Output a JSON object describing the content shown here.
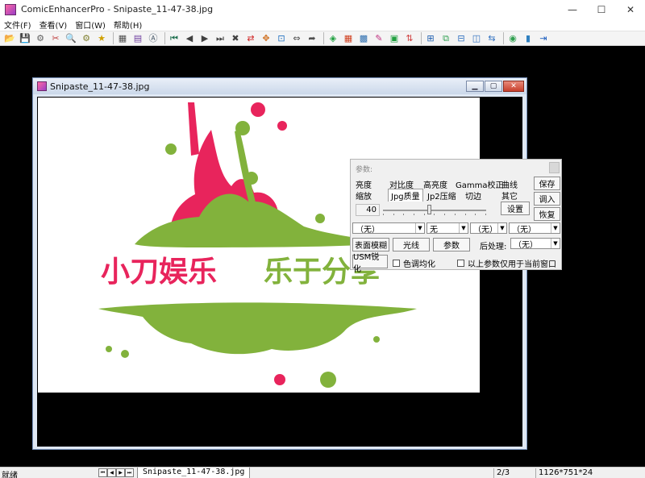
{
  "window": {
    "title": "ComicEnhancerPro - Snipaste_11-47-38.jpg",
    "minimize": "—",
    "maximize": "☐",
    "close": "✕"
  },
  "menu": [
    "文件(F)",
    "查看(V)",
    "窗口(W)",
    "帮助(H)"
  ],
  "toolbar": [
    {
      "icon": "open-folder-icon",
      "glyph": "📂"
    },
    {
      "icon": "save-icon",
      "glyph": "💾"
    },
    {
      "icon": "batch-icon",
      "glyph": "⚙"
    },
    {
      "icon": "tools-icon",
      "glyph": "✂"
    },
    {
      "icon": "zoom-icon",
      "glyph": "🔍"
    },
    {
      "icon": "settings-icon",
      "glyph": "⚙"
    },
    {
      "icon": "star-icon",
      "glyph": "★"
    },
    {
      "sep": true
    },
    {
      "icon": "palette-icon",
      "glyph": "▦"
    },
    {
      "icon": "pages-icon",
      "glyph": "▤"
    },
    {
      "icon": "text-icon",
      "glyph": "Ⓐ"
    },
    {
      "sep": true
    },
    {
      "icon": "first-icon",
      "glyph": "⏮"
    },
    {
      "icon": "prev-icon",
      "glyph": "◀"
    },
    {
      "icon": "next-icon",
      "glyph": "▶"
    },
    {
      "icon": "last-icon",
      "glyph": "⏭"
    },
    {
      "icon": "delete-icon",
      "glyph": "✖"
    },
    {
      "icon": "swap-icon",
      "glyph": "⇄"
    },
    {
      "icon": "move-icon",
      "glyph": "✥"
    },
    {
      "icon": "fit-icon",
      "glyph": "⊡"
    },
    {
      "icon": "fit-width-icon",
      "glyph": "⇔"
    },
    {
      "icon": "export-icon",
      "glyph": "➦"
    },
    {
      "sep": true
    },
    {
      "icon": "color-icon",
      "glyph": "◈"
    },
    {
      "icon": "grid-icon",
      "glyph": "▦"
    },
    {
      "icon": "mosaic-icon",
      "glyph": "▩"
    },
    {
      "icon": "brush-icon",
      "glyph": "✎"
    },
    {
      "icon": "frame-icon",
      "glyph": "▣"
    },
    {
      "icon": "sort-icon",
      "glyph": "⇅"
    },
    {
      "sep": true
    },
    {
      "icon": "add-page-icon",
      "glyph": "⊞"
    },
    {
      "icon": "copy-page-icon",
      "glyph": "⧉"
    },
    {
      "icon": "split-h-icon",
      "glyph": "⊟"
    },
    {
      "icon": "split-v-icon",
      "glyph": "◫"
    },
    {
      "icon": "convert-icon",
      "glyph": "⇆"
    },
    {
      "sep": true
    },
    {
      "icon": "globe-icon",
      "glyph": "◉"
    },
    {
      "icon": "help-book-icon",
      "glyph": "▮"
    },
    {
      "icon": "exit-icon",
      "glyph": "⇥"
    }
  ],
  "child": {
    "title": "Snipaste_11-47-38.jpg",
    "minimize": "▁",
    "maximize": "▢",
    "close": "✕"
  },
  "image": {
    "text_left": "小刀娱乐",
    "text_right": "乐于分享",
    "pink": "#e8245c",
    "green": "#82b23c"
  },
  "params": {
    "title": "参数:",
    "tabs_row1": [
      "亮度",
      "对比度",
      "高亮度",
      "Gamma校正",
      "曲线"
    ],
    "tabs_row2": [
      "缩放",
      "Jpg质量",
      "Jp2压缩",
      "切边",
      "其它"
    ],
    "value": "40",
    "set_btn": "设置",
    "save_btn": "保存",
    "apply_btn": "调入",
    "restore_btn": "恢复",
    "combo1": "（无）",
    "combo2": "无",
    "combo3": "（无）",
    "combo4": "（无）",
    "btn_surface_blur": "表面模糊",
    "btn_light": "光线",
    "btn_params": "参数",
    "post_label": "后处理:",
    "post_combo": "（无）",
    "btn_usm": "USM锐化",
    "chk_color_equalize": "色调均化",
    "chk_current_only": "以上参数仅用于当前窗口"
  },
  "status": {
    "ready": "就绪",
    "tab": "Snipaste_11-47-38.jpg",
    "pages": "2/3",
    "dims": "1126*751*24"
  }
}
